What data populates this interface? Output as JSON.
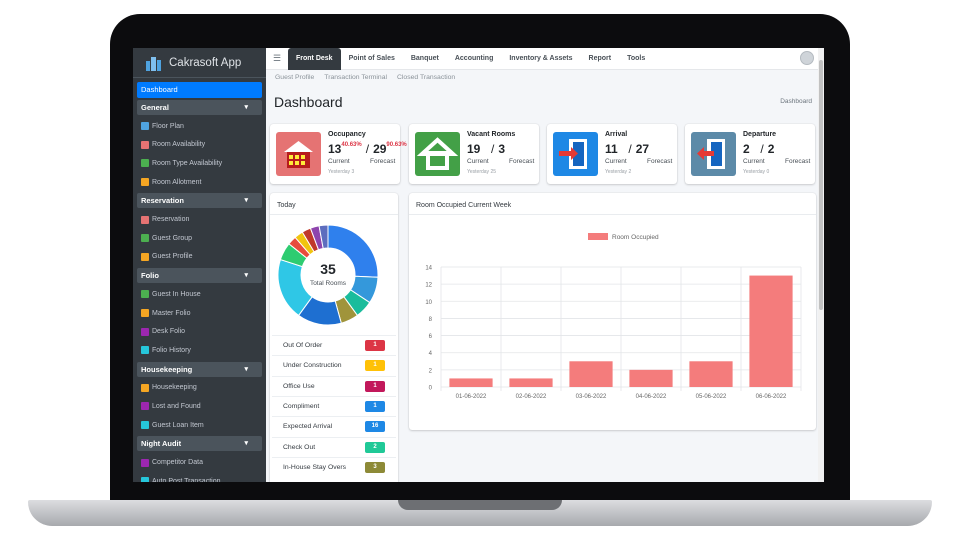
{
  "app": {
    "name": "Cakrasoft App"
  },
  "sidebar": {
    "active": "Dashboard",
    "groups": [
      {
        "label": "General",
        "items": [
          "Floor Plan",
          "Room Availability",
          "Room Type Availability",
          "Room Allotment"
        ]
      },
      {
        "label": "Reservation",
        "items": [
          "Reservation",
          "Guest Group",
          "Guest Profile"
        ]
      },
      {
        "label": "Folio",
        "items": [
          "Guest In House",
          "Master Folio",
          "Desk Folio",
          "Folio History"
        ]
      },
      {
        "label": "Housekeeping",
        "items": [
          "Housekeeping",
          "Lost and Found",
          "Guest Loan Item"
        ]
      },
      {
        "label": "Night Audit",
        "items": [
          "Competitor Data",
          "Auto Post Transaction"
        ]
      }
    ]
  },
  "topbar": {
    "tabs": [
      "Front Desk",
      "Point of Sales",
      "Banquet",
      "Accounting",
      "Inventory & Assets",
      "Report",
      "Tools"
    ],
    "active_tab": "Front Desk"
  },
  "subnav": [
    "Guest Profile",
    "Transaction Terminal",
    "Closed Transaction"
  ],
  "page": {
    "title": "Dashboard",
    "breadcrumb": "Dashboard"
  },
  "stats": [
    {
      "label": "Occupancy",
      "current": "13",
      "current_pct": "40.63%",
      "sep": "/",
      "forecast": "29",
      "forecast_pct": "90.63%",
      "current_label": "Current",
      "forecast_label": "Forecast",
      "yesterday": "Yesterday 3",
      "icon": "hotel-icon",
      "color": "#e57373"
    },
    {
      "label": "Vacant Rooms",
      "current": "19",
      "sep": "/",
      "forecast": "3",
      "current_label": "Current",
      "forecast_label": "Forecast",
      "yesterday": "Yesterday 25",
      "icon": "house-icon",
      "color": "#43a047"
    },
    {
      "label": "Arrival",
      "current": "11",
      "sep": "/",
      "forecast": "27",
      "current_label": "Current",
      "forecast_label": "Forecast",
      "yesterday": "Yesterday 2",
      "icon": "door-in-icon",
      "color": "#1e88e5"
    },
    {
      "label": "Departure",
      "current": "2",
      "sep": "/",
      "forecast": "2",
      "current_label": "Current",
      "forecast_label": "Forecast",
      "yesterday": "Yesterday 0",
      "icon": "door-out-icon",
      "color": "#5c8aa8"
    }
  ],
  "today": {
    "title": "Today",
    "total": "35",
    "total_label": "Total Rooms",
    "rows": [
      {
        "label": "Out Of Order",
        "value": "1",
        "color": "#dc3545"
      },
      {
        "label": "Under Construction",
        "value": "1",
        "color": "#ffc107"
      },
      {
        "label": "Office Use",
        "value": "1",
        "color": "#c2185b"
      },
      {
        "label": "Compliment",
        "value": "1",
        "color": "#1e88e5"
      },
      {
        "label": "Expected Arrival",
        "value": "16",
        "color": "#1e88e5"
      },
      {
        "label": "Check Out",
        "value": "2",
        "color": "#20c997"
      },
      {
        "label": "In-House Stay Overs",
        "value": "3",
        "color": "#8d8a37"
      }
    ],
    "donut": [
      {
        "value": 9,
        "color": "#2f80ed"
      },
      {
        "value": 3,
        "color": "#3498db"
      },
      {
        "value": 2,
        "color": "#1abc9c"
      },
      {
        "value": 2,
        "color": "#a0943b"
      },
      {
        "value": 5,
        "color": "#1e6fd1"
      },
      {
        "value": 7,
        "color": "#2fc7e6"
      },
      {
        "value": 2,
        "color": "#2ecc71"
      },
      {
        "value": 1,
        "color": "#e74c3c"
      },
      {
        "value": 1,
        "color": "#f1c40f"
      },
      {
        "value": 1,
        "color": "#c0392b"
      },
      {
        "value": 1,
        "color": "#8e44ad"
      },
      {
        "value": 1,
        "color": "#5d6dbe"
      }
    ]
  },
  "chart_data": {
    "type": "bar",
    "title": "Room Occupied Current Week",
    "categories": [
      "01-06-2022",
      "02-06-2022",
      "03-06-2022",
      "04-06-2022",
      "05-06-2022",
      "06-06-2022"
    ],
    "series": [
      {
        "name": "Room Occupied",
        "values": [
          1,
          1,
          3,
          2,
          3,
          13
        ],
        "color": "#f47c7c"
      }
    ],
    "ylim": [
      0,
      14
    ],
    "yticks": [
      0,
      2,
      4,
      6,
      8,
      10,
      12,
      14
    ],
    "grid": true,
    "legend": "top-center"
  }
}
